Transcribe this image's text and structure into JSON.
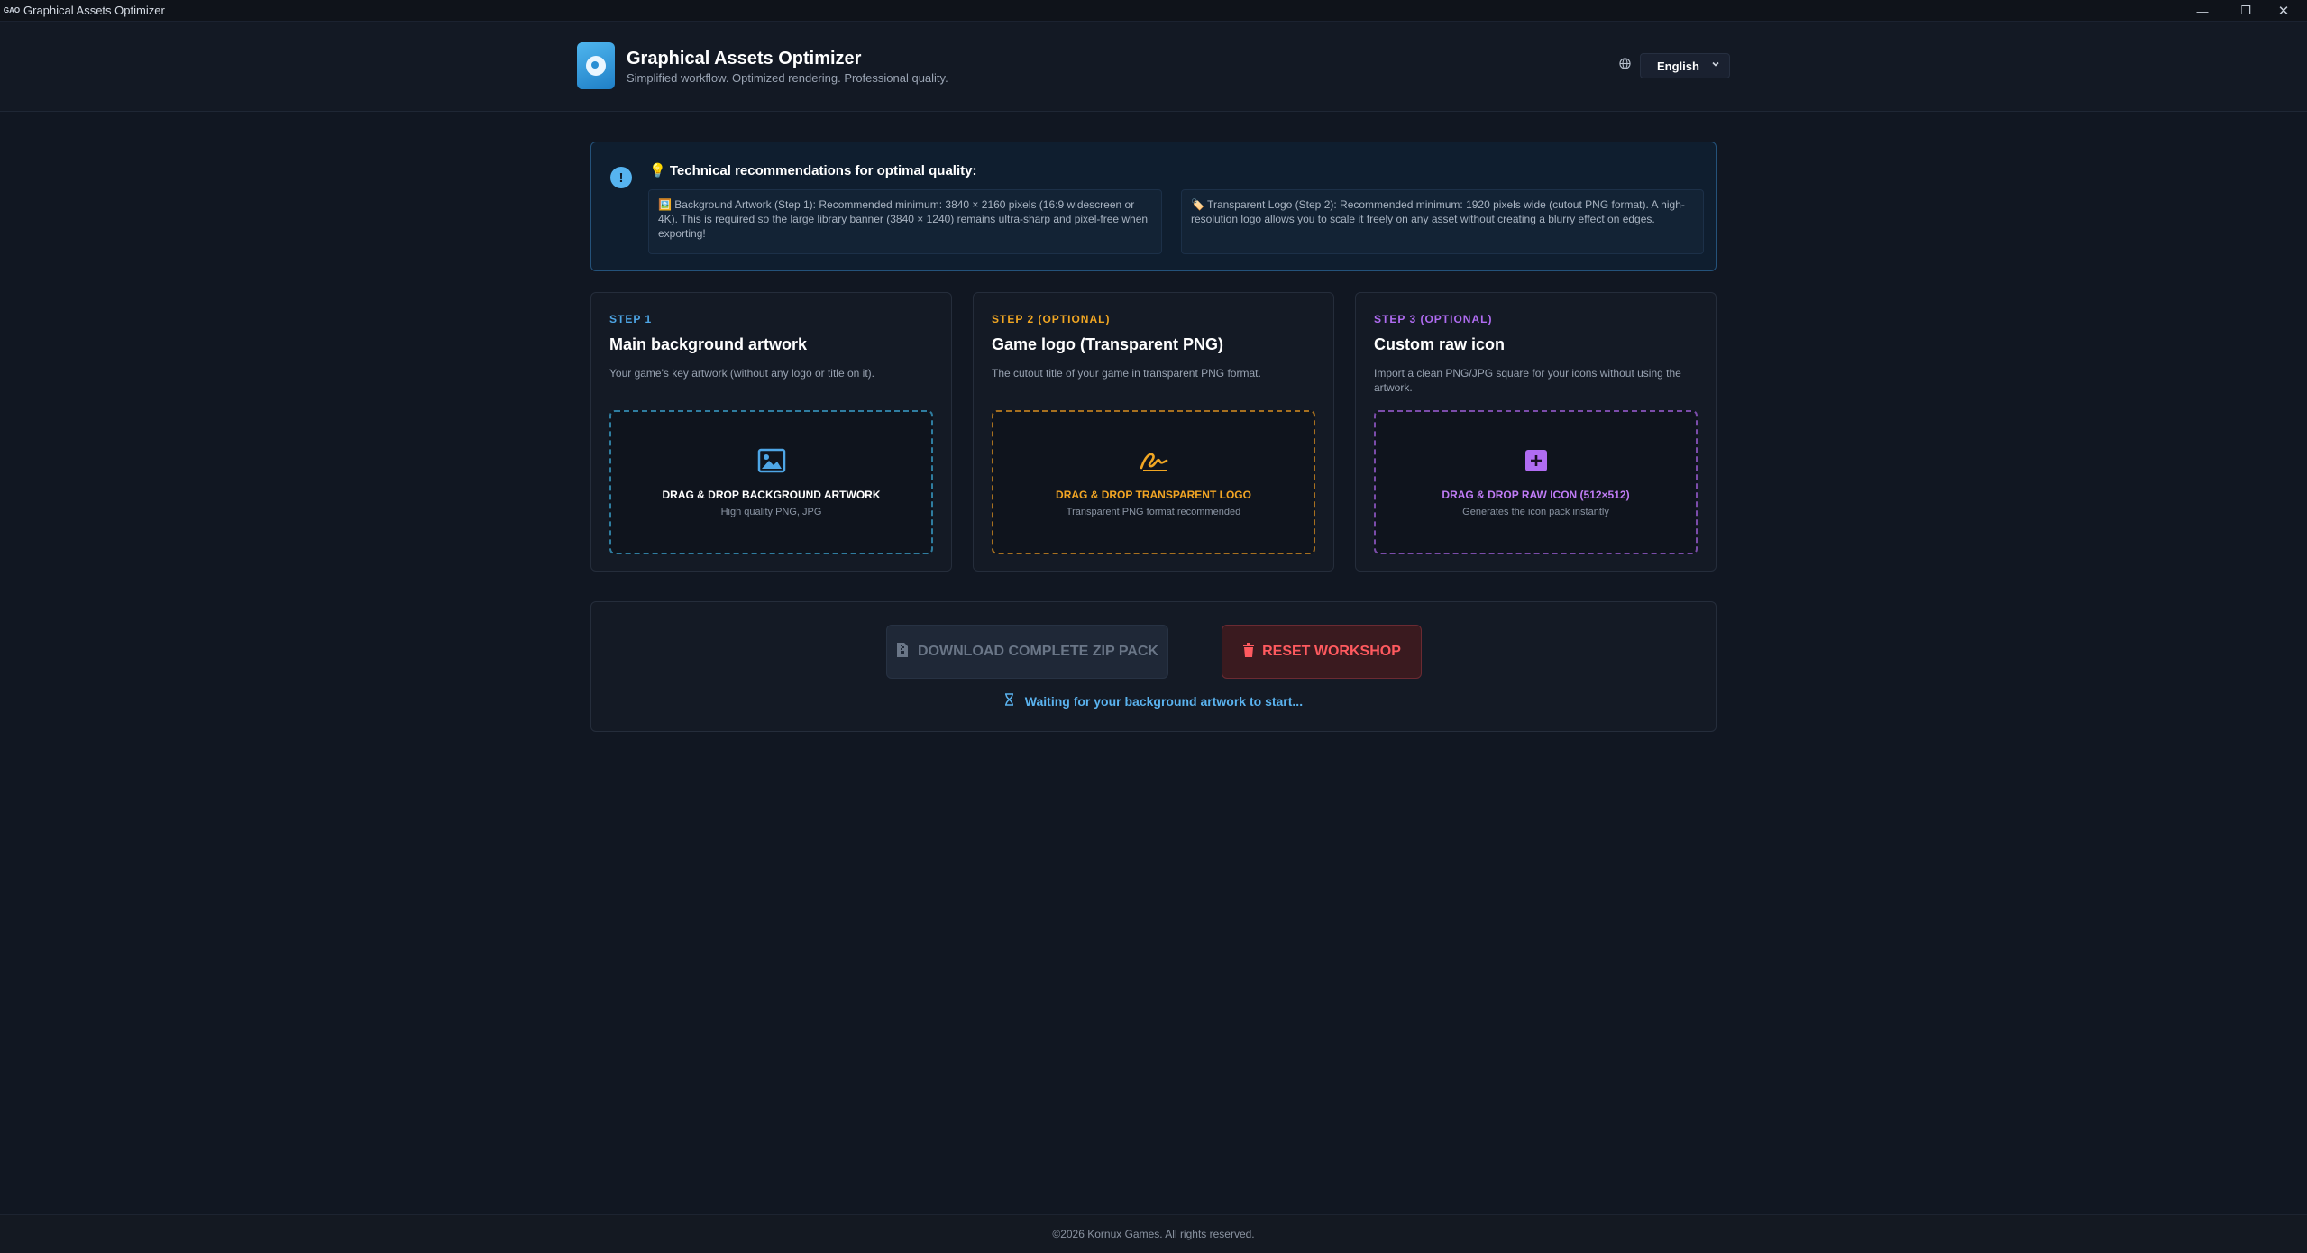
{
  "window": {
    "app_icon": "GAO",
    "title": "Graphical Assets Optimizer",
    "controls": {
      "minimize": "—",
      "maximize": "❐",
      "close": "✕"
    }
  },
  "header": {
    "title": "Graphical Assets Optimizer",
    "subtitle": "Simplified workflow. Optimized rendering. Professional quality.",
    "language_icon": "globe-icon",
    "language": "English"
  },
  "recommendations": {
    "icon": "!",
    "title": "💡 Technical recommendations for optimal quality:",
    "items": [
      "🖼️ Background Artwork (Step 1): Recommended minimum: 3840 × 2160 pixels (16:9 widescreen or 4K). This is required so the large library banner (3840 × 1240) remains ultra-sharp and pixel-free when exporting!",
      "🏷️ Transparent Logo (Step 2): Recommended minimum: 1920 pixels wide (cutout PNG format). A high-resolution logo allows you to scale it freely on any asset without creating a blurry effect on edges."
    ]
  },
  "steps": [
    {
      "tag": "STEP 1",
      "title": "Main background artwork",
      "description": "Your game's key artwork (without any logo or title on it).",
      "drop_title": "DRAG & DROP BACKGROUND ARTWORK",
      "drop_sub": "High quality PNG, JPG",
      "icon": "image-icon",
      "color": "#4ea6e6"
    },
    {
      "tag": "STEP 2 (OPTIONAL)",
      "title": "Game logo (Transparent PNG)",
      "description": "The cutout title of your game in transparent PNG format.",
      "drop_title": "DRAG & DROP TRANSPARENT LOGO",
      "drop_sub": "Transparent PNG format recommended",
      "icon": "signature-icon",
      "color": "#f0a623"
    },
    {
      "tag": "STEP 3 (OPTIONAL)",
      "title": "Custom raw icon",
      "description": "Import a clean PNG/JPG square for your icons without using the artwork.",
      "drop_title": "DRAG & DROP RAW ICON (512×512)",
      "drop_sub": "Generates the icon pack instantly",
      "icon": "plus-square-icon",
      "color": "#b06cf2"
    }
  ],
  "actions": {
    "download_label": "DOWNLOAD COMPLETE ZIP PACK",
    "reset_label": "RESET WORKSHOP",
    "status": "Waiting for your background artwork to start..."
  },
  "footer": {
    "copyright": "©2026 Kornux Games. All rights reserved."
  }
}
